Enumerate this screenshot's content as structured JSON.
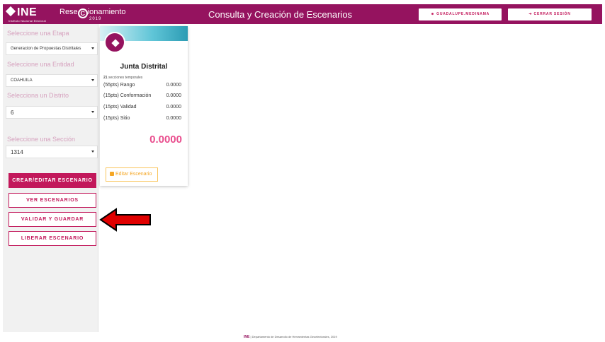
{
  "header": {
    "logo_text": "INE",
    "logo_subtitle": "Instituto Nacional Electoral",
    "brand_prefix": "Rese",
    "brand_c": "C",
    "brand_suffix": "ionamiento",
    "brand_year": "2019",
    "title": "Consulta y Creación de Escenarios",
    "user_button": "GUADALUPE.MEDINAMA",
    "logout_button": "CERRAR SESIÓN",
    "user_icon": "user-icon",
    "logout_icon": "logout-icon"
  },
  "sidebar": {
    "etapa_label": "Seleccione una Etapa",
    "etapa_value": "Generacion de Propuestas Distritales",
    "entidad_label": "Seleccione una Entidad",
    "entidad_value": "COAHUILA",
    "distrito_label": "Selecciona un Distrito",
    "distrito_value": "6",
    "seccion_label": "Seleccione una Sección",
    "seccion_value": "1314"
  },
  "buttons": {
    "crear": "CREAR/EDITAR ESCENARIO",
    "ver": "VER ESCENARIOS",
    "validar": "VALIDAR Y GUARDAR",
    "liberar": "LIBERAR ESCENARIO"
  },
  "card": {
    "title": "Junta Distrital",
    "sections_count": "21",
    "sections_text": "secciones temporales",
    "metrics": [
      {
        "label": "(55pts)  Rango",
        "value": "0.0000"
      },
      {
        "label": "(15pts)  Conformación",
        "value": "0.0000"
      },
      {
        "label": "(15pts)  Validad",
        "value": "0.0000"
      },
      {
        "label": "(15pts)  Sitio",
        "value": "0.0000"
      }
    ],
    "score": "0.0000",
    "edit_button": "Editar Escenario"
  },
  "footer": {
    "logo": "INE",
    "text": "| Departamento de Desarrollo de Herramientas Geoelectorales, 2019"
  },
  "colors": {
    "brand": "#95135f",
    "accent": "#c2185b",
    "score": "#e94d8d",
    "edit": "#f5a623",
    "arrow": "#e00000"
  }
}
